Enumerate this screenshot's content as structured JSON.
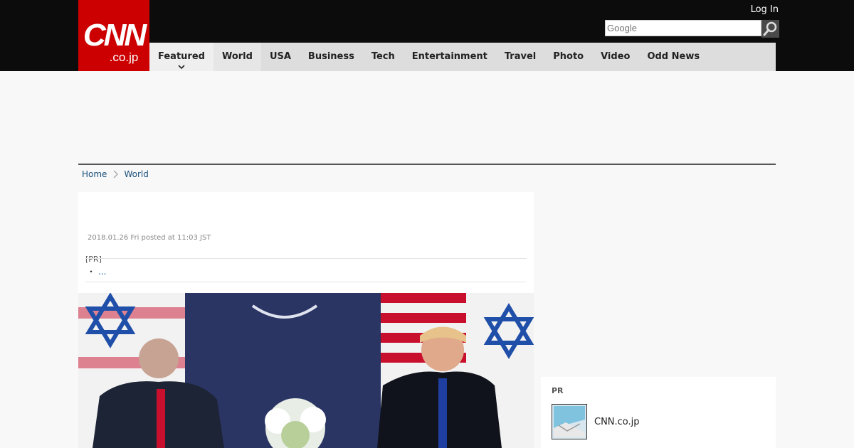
{
  "header": {
    "logo": {
      "main": "CNN",
      "sub": ".co.jp"
    },
    "login": "Log In",
    "search": {
      "placeholder": "Google",
      "button_icon": "search-icon"
    }
  },
  "nav": {
    "items": [
      {
        "label": "Featured",
        "has_dropdown": true
      },
      {
        "label": "World",
        "selected": true
      },
      {
        "label": "USA"
      },
      {
        "label": "Business"
      },
      {
        "label": "Tech"
      },
      {
        "label": "Entertainment"
      },
      {
        "label": "Travel"
      },
      {
        "label": "Photo"
      },
      {
        "label": "Video"
      },
      {
        "label": "Odd News"
      }
    ]
  },
  "breadcrumb": {
    "home": "Home",
    "current": "World"
  },
  "article": {
    "date": "2018.01.26 Fri posted at 11:03 JST",
    "pr_label": "[PR]",
    "pr_bullet": "・",
    "pr_link": "..."
  },
  "sidebar": {
    "pr_title": "PR",
    "pr_item": "CNN.co.jp"
  },
  "colors": {
    "brand_red": "#cc0000",
    "topbar": "#0c0c0c",
    "nav_bg": "#dddddd",
    "link": "#1a4f7a"
  }
}
